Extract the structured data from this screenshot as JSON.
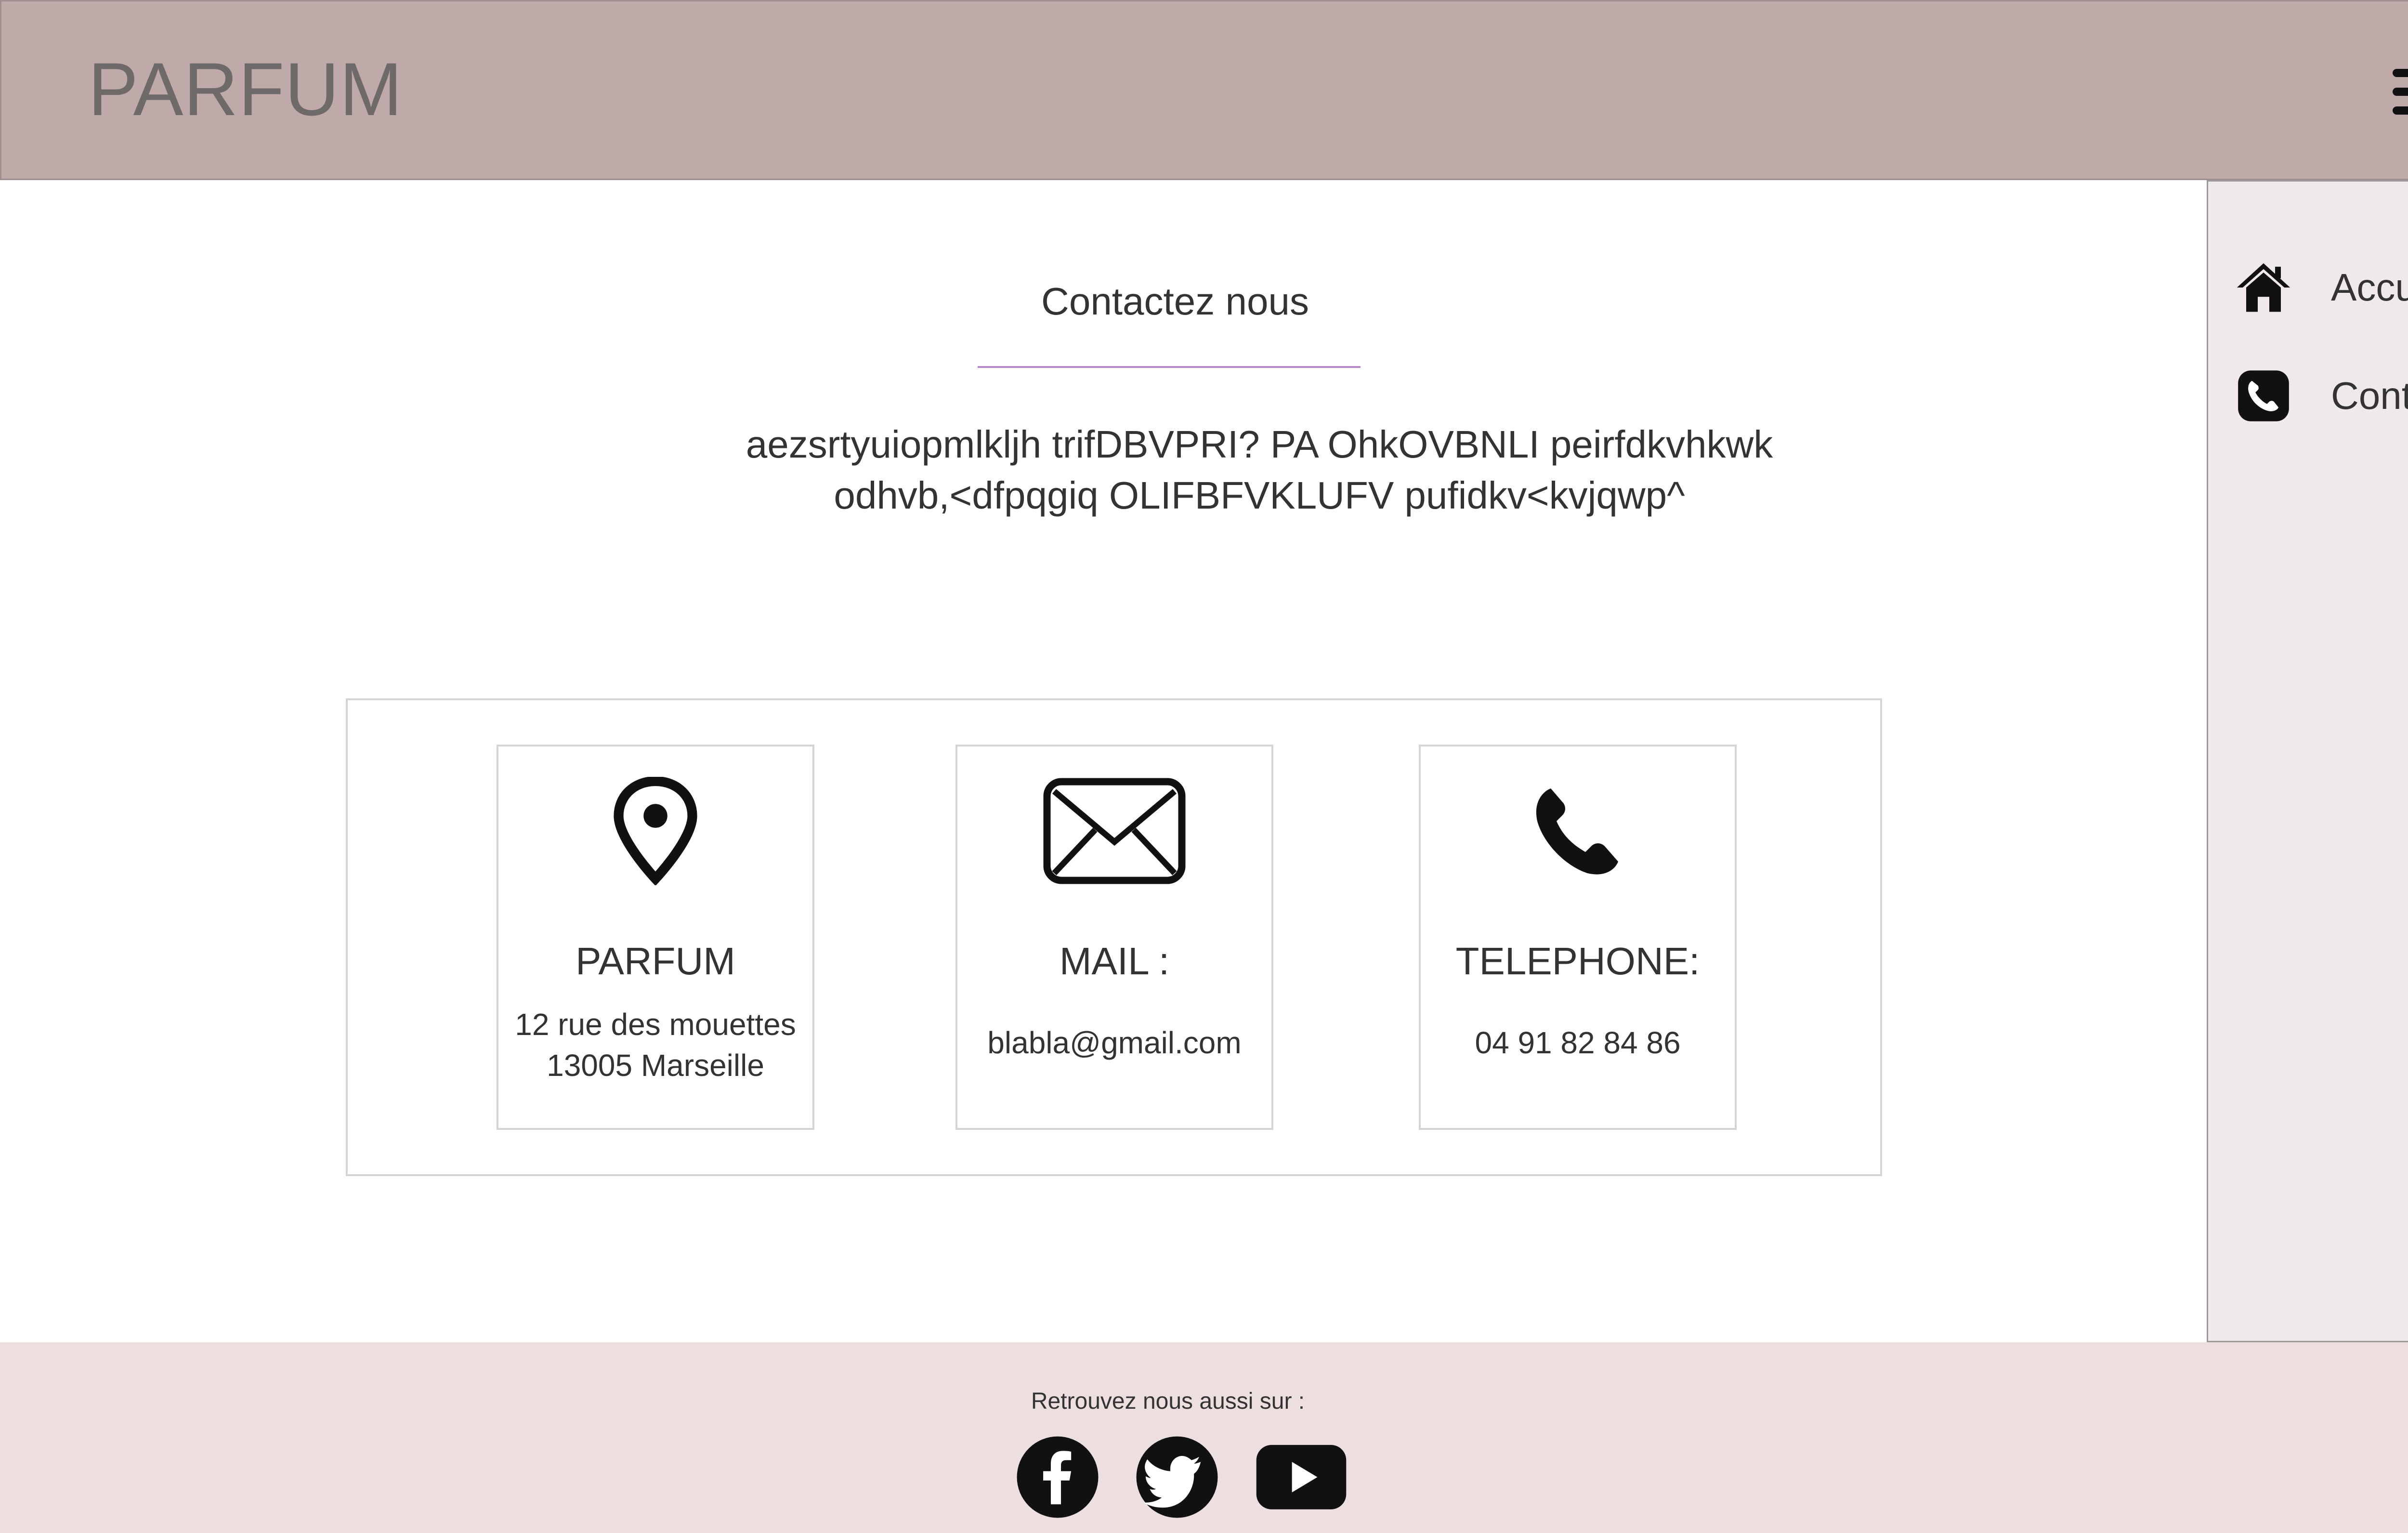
{
  "header": {
    "brand": "PARFUM",
    "menu_icon": "hamburger-menu-icon"
  },
  "sidebar": {
    "items": [
      {
        "label": "Accueil",
        "icon": "home-icon"
      },
      {
        "label": "Contacts",
        "icon": "phone-square-icon"
      }
    ]
  },
  "main": {
    "title": "Contactez nous",
    "intro_line1": "aezsrtyuiopmlkljh trifDBVPRI? PA OhkOVBNLI peirfdkvhkwk",
    "intro_line2": "odhvb,<dfpqgiq OLIFBFVKLUFV pufidkv<kvjqwp^"
  },
  "cards": [
    {
      "icon": "location-pin-icon",
      "title": "PARFUM",
      "line1": "12 rue des mouettes",
      "line2": "13005 Marseille"
    },
    {
      "icon": "envelope-icon",
      "title": "MAIL :",
      "line1": "blabla@gmail.com"
    },
    {
      "icon": "phone-icon",
      "title": "TELEPHONE:",
      "line1": "04 91 82 84 86"
    }
  ],
  "footer": {
    "follow_text": "Retrouvez nous aussi sur :",
    "social": [
      {
        "icon": "facebook-icon"
      },
      {
        "icon": "twitter-icon"
      },
      {
        "icon": "youtube-icon"
      }
    ]
  }
}
